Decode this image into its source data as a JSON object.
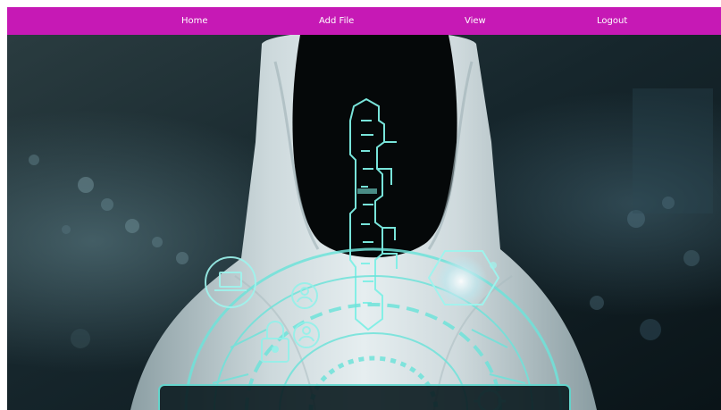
{
  "nav": {
    "background_color": "#c619b5",
    "text_color": "#ffffff",
    "items": [
      {
        "label": "Home"
      },
      {
        "label": "Add File"
      },
      {
        "label": "View"
      },
      {
        "label": "Logout"
      }
    ]
  },
  "hero": {
    "subject": "hooded-figure-with-digital-key",
    "accent_color": "#7ff0e6"
  }
}
